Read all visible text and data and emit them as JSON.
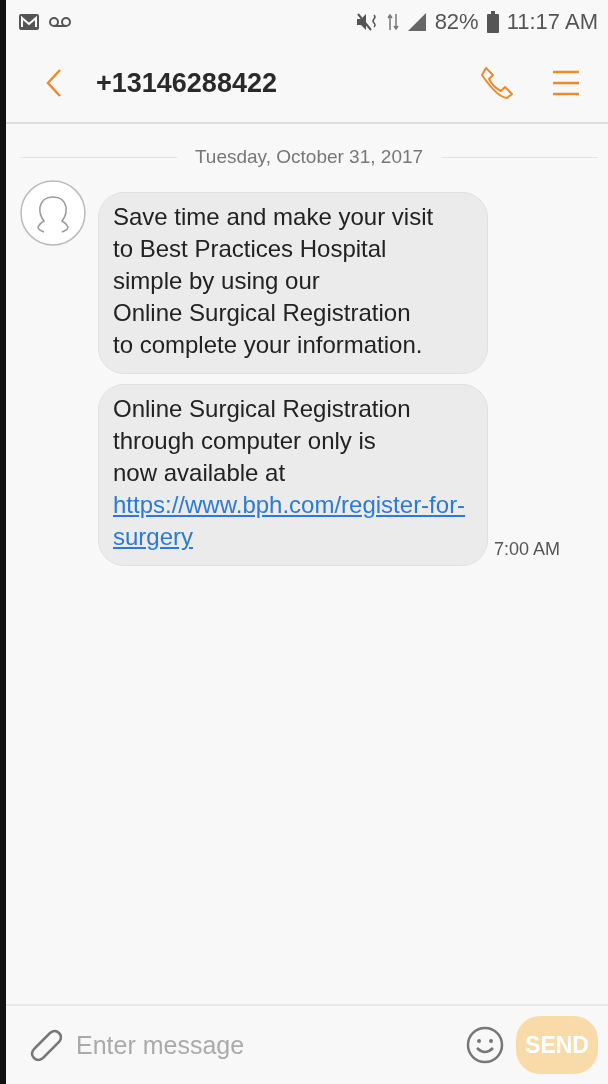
{
  "status_bar": {
    "battery": "82%",
    "time": "11:17 AM"
  },
  "header": {
    "title": "+13146288422"
  },
  "date_divider": "Tuesday, October 31, 2017",
  "messages": [
    {
      "lines": [
        "Save time and make your visit",
        "to Best Practices Hospital",
        "simple by using our",
        "Online Surgical Registration",
        "to complete your information."
      ]
    },
    {
      "lines": [
        "Online Surgical Registration",
        "through computer only is",
        "now available at"
      ],
      "link": "https://www.bph.com/register-for-surgery",
      "time": "7:00 AM"
    }
  ],
  "composer": {
    "placeholder": "Enter message",
    "send": "SEND",
    "send_disabled": true
  }
}
